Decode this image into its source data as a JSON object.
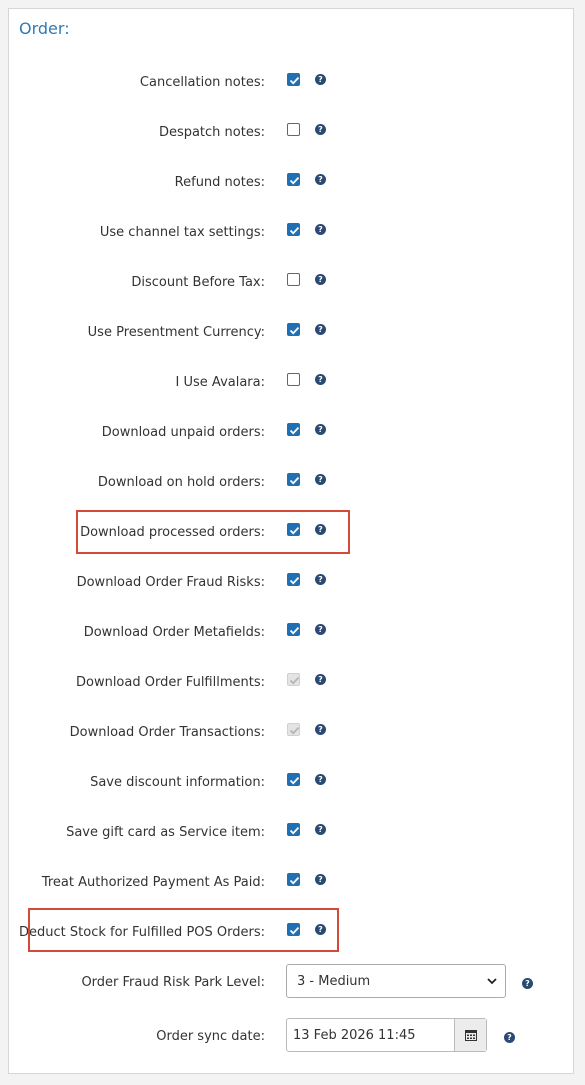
{
  "section": {
    "title": "Order:"
  },
  "settings": [
    {
      "label": "Cancellation notes:",
      "state": "checked"
    },
    {
      "label": "Despatch notes:",
      "state": "unchecked"
    },
    {
      "label": "Refund notes:",
      "state": "checked"
    },
    {
      "label": "Use channel tax settings:",
      "state": "checked"
    },
    {
      "label": "Discount Before Tax:",
      "state": "unchecked"
    },
    {
      "label": "Use Presentment Currency:",
      "state": "checked"
    },
    {
      "label": "I Use Avalara:",
      "state": "unchecked"
    },
    {
      "label": "Download unpaid orders:",
      "state": "checked"
    },
    {
      "label": "Download on hold orders:",
      "state": "checked"
    },
    {
      "label": "Download processed orders:",
      "state": "checked"
    },
    {
      "label": "Download Order Fraud Risks:",
      "state": "checked"
    },
    {
      "label": "Download Order Metafields:",
      "state": "checked"
    },
    {
      "label": "Download Order Fulfillments:",
      "state": "disabled"
    },
    {
      "label": "Download Order Transactions:",
      "state": "disabled"
    },
    {
      "label": "Save discount information:",
      "state": "checked"
    },
    {
      "label": "Save gift card as Service item:",
      "state": "checked"
    },
    {
      "label": "Treat Authorized Payment As Paid:",
      "state": "checked"
    },
    {
      "label": "Deduct Stock for Fulfilled POS Orders:",
      "state": "checked"
    }
  ],
  "fraud_risk": {
    "label": "Order Fraud Risk Park Level:",
    "value": "3 - Medium"
  },
  "sync_date": {
    "label": "Order sync date:",
    "value": "13 Feb 2026 11:45"
  },
  "icons": {
    "help": "question-circle-icon",
    "calendar": "calendar-icon",
    "dropdown": "chevron-down-icon"
  },
  "colors": {
    "accent": "#1f6fb2",
    "title": "#2f7ab5",
    "highlight": "#d44a37",
    "help": "#2a4a72"
  }
}
